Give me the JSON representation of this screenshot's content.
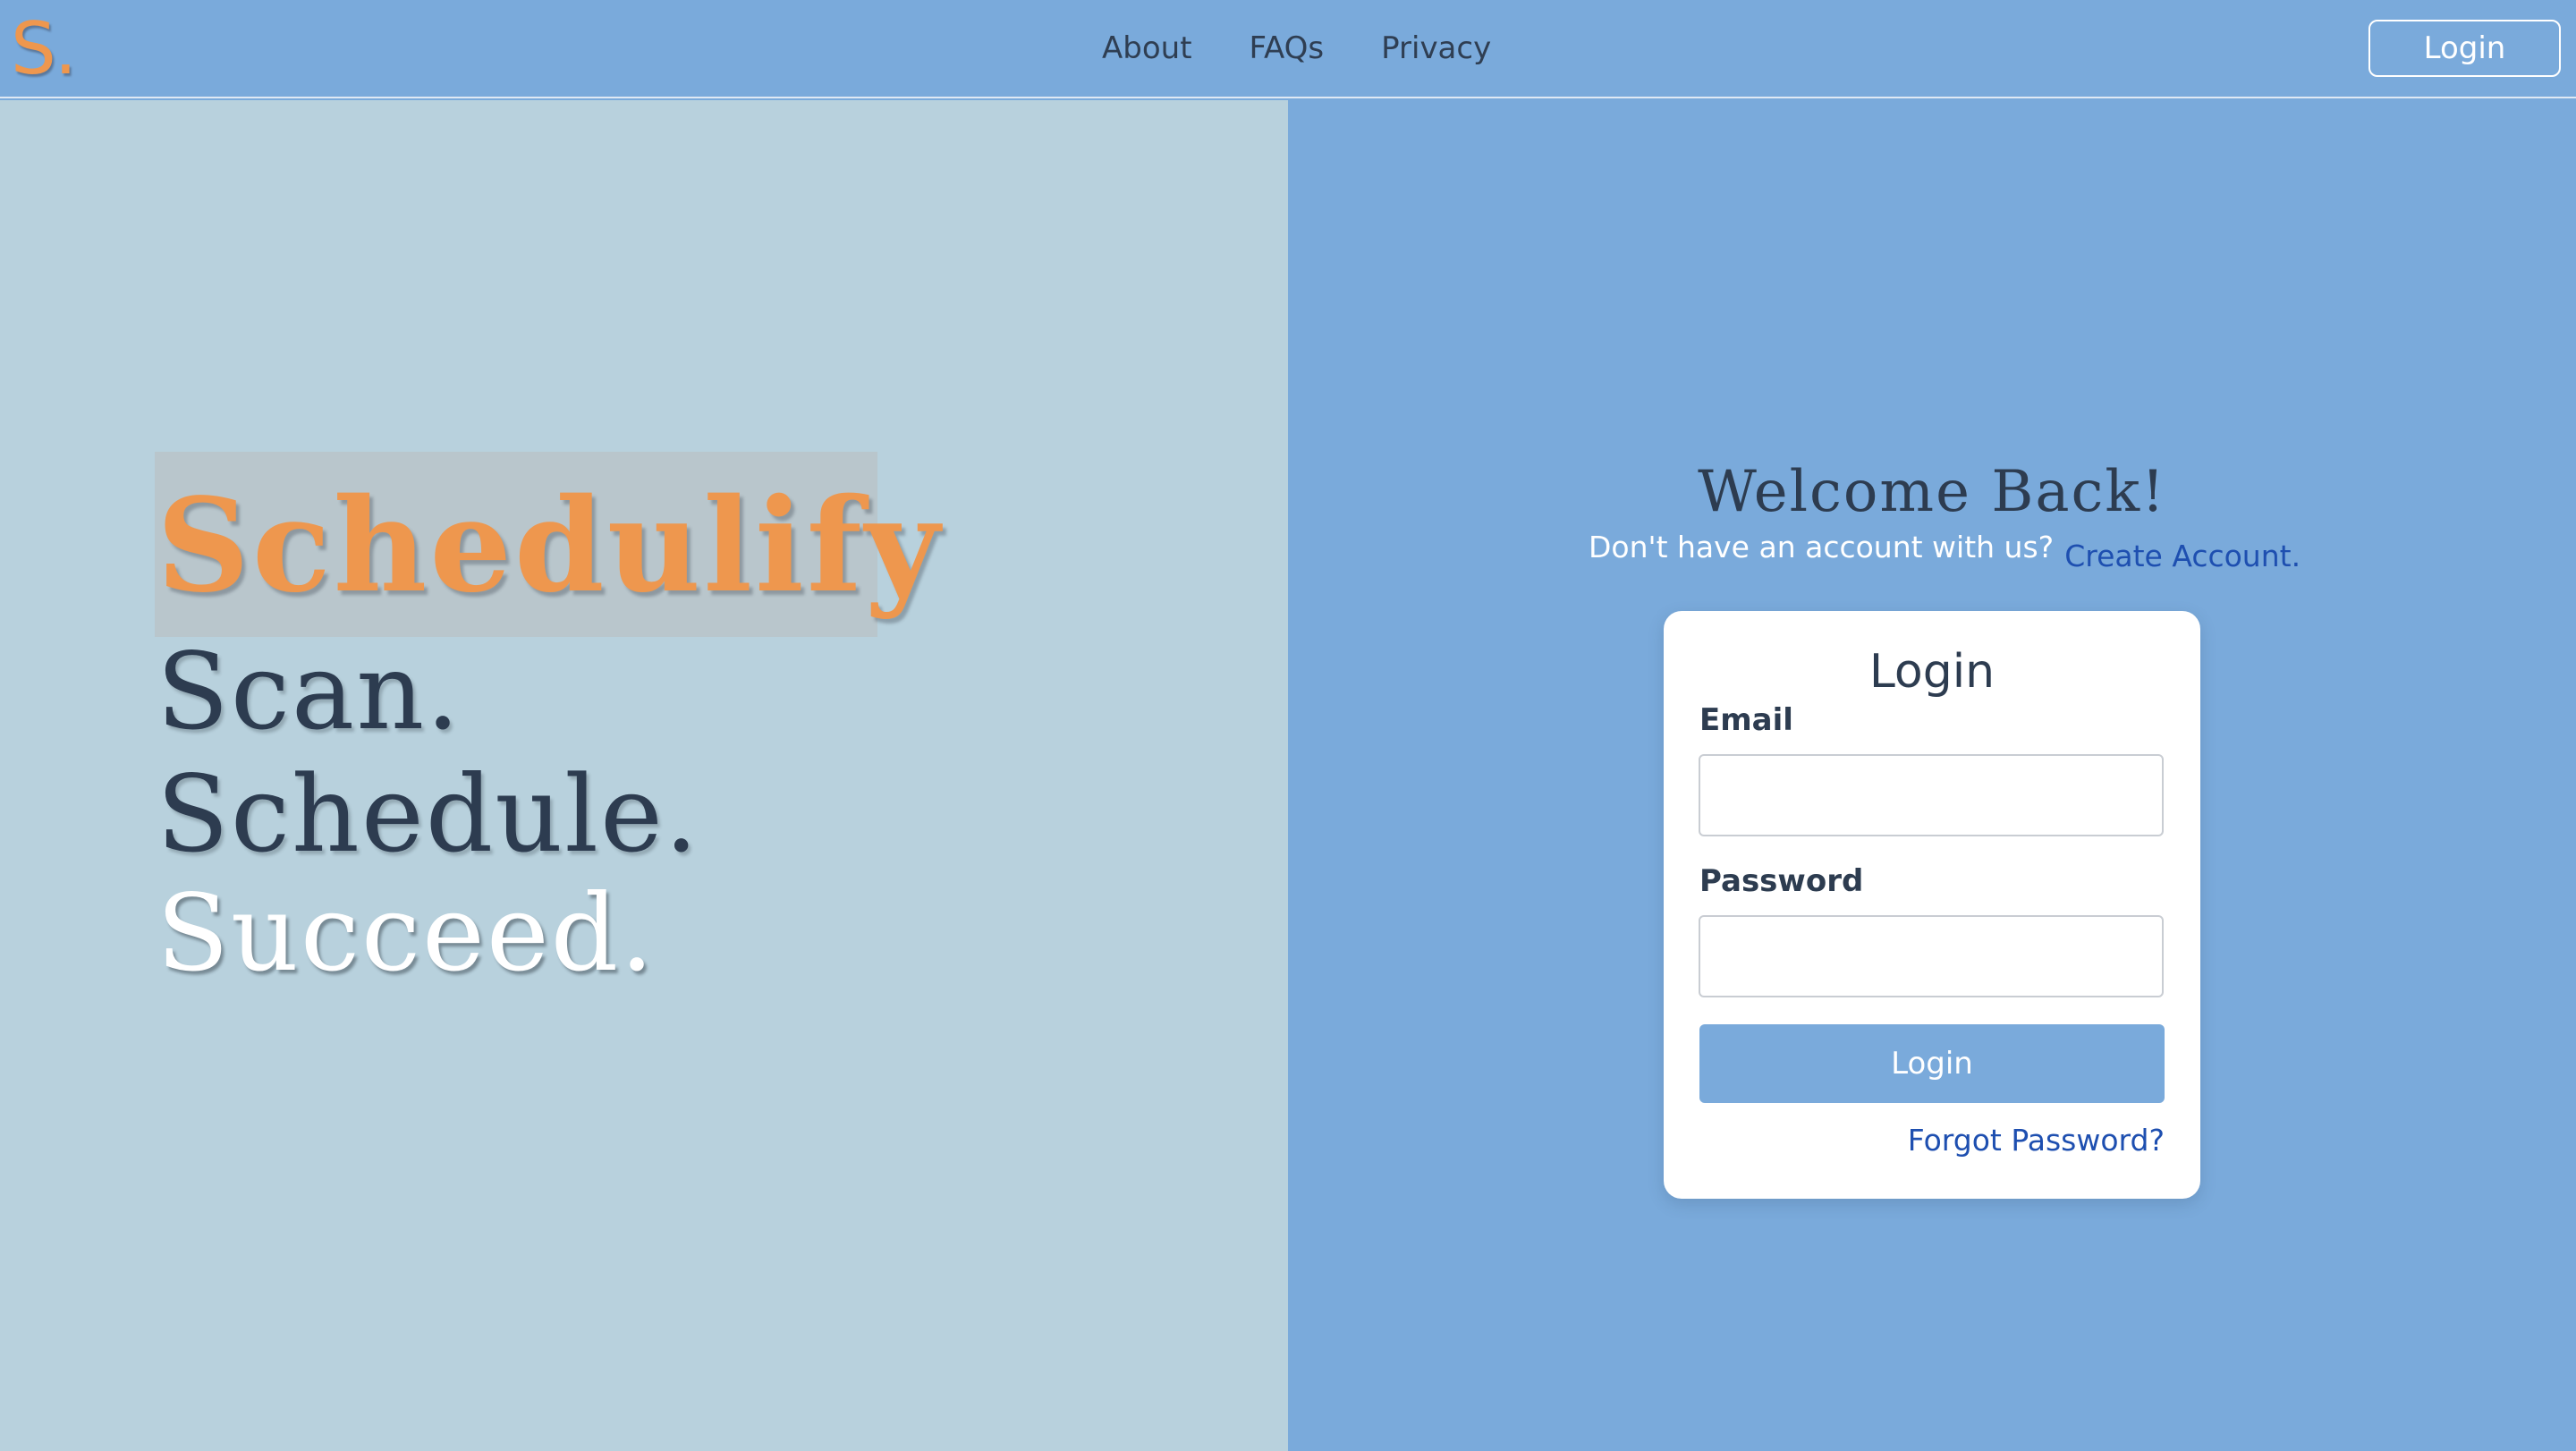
{
  "colors": {
    "nav_bg": "#7aaadb",
    "left_bg": "#b8d1dd",
    "right_bg": "#7aaadb",
    "accent_orange": "#ee974e",
    "text_dark": "#2d3c50",
    "link_blue": "#1e4fb0",
    "card_bg": "#ffffff"
  },
  "navbar": {
    "logo_text": "S.",
    "links": [
      "About",
      "FAQs",
      "Privacy"
    ],
    "login_label": "Login"
  },
  "hero": {
    "brand": "Schedulify",
    "taglines": [
      "Scan.",
      "Schedule.",
      "Succeed."
    ]
  },
  "welcome": {
    "title": "Welcome Back!",
    "prompt": "Don't have an account with us?",
    "create_link": "Create Account."
  },
  "login_card": {
    "title": "Login",
    "email_label": "Email",
    "email_value": "",
    "password_label": "Password",
    "password_value": "",
    "submit_label": "Login",
    "forgot_link": "Forgot Password?"
  }
}
